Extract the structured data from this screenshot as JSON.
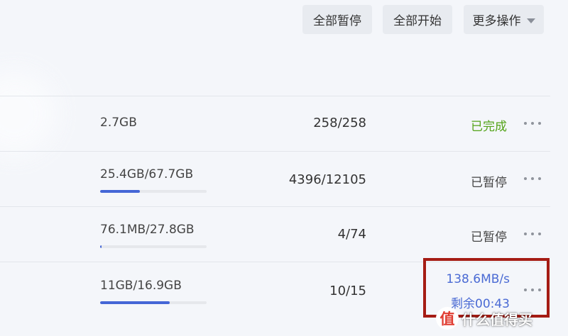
{
  "toolbar": {
    "pause_all_label": "全部暂停",
    "start_all_label": "全部开始",
    "more_label": "更多操作"
  },
  "tasks": [
    {
      "size": "2.7GB",
      "progress": null,
      "count": "258/258",
      "status": "已完成",
      "status_type": "done"
    },
    {
      "size": "25.4GB/67.7GB",
      "progress": 0.375,
      "count": "4396/12105",
      "status": "已暂停",
      "status_type": "paused"
    },
    {
      "size": "76.1MB/27.8GB",
      "progress": 0.003,
      "count": "4/74",
      "status": "已暂停",
      "status_type": "paused"
    },
    {
      "size": "11GB/16.9GB",
      "progress": 0.65,
      "count": "10/15",
      "speed": "138.6MB/s",
      "remaining": "剩余00:43",
      "status_type": "downloading"
    }
  ],
  "watermark": {
    "badge": "值",
    "text": "什么值得买"
  },
  "colors": {
    "accent": "#4466d6",
    "done": "#53a318",
    "speed_text": "#4a6ad4",
    "highlight_box": "#a51c14"
  }
}
